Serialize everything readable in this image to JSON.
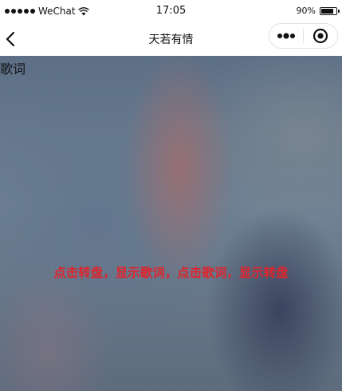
{
  "status_bar": {
    "carrier": "WeChat",
    "time": "17:05",
    "battery_text": "90%",
    "battery_level": 0.9,
    "signal_dots": 5,
    "wifi_icon": "wifi-icon",
    "battery_icon": "battery-icon"
  },
  "nav_bar": {
    "title": "天若有情",
    "back_icon": "chevron-left-icon",
    "more_icon": "more-dots-icon",
    "close_icon": "target-close-icon"
  },
  "content": {
    "lyrics_label": "歌词",
    "hint_text": "点击转盘，显示歌词，点击歌词，显示转盘"
  },
  "colors": {
    "hint_red": "#e0242c",
    "bar_background": "#ffffff"
  }
}
